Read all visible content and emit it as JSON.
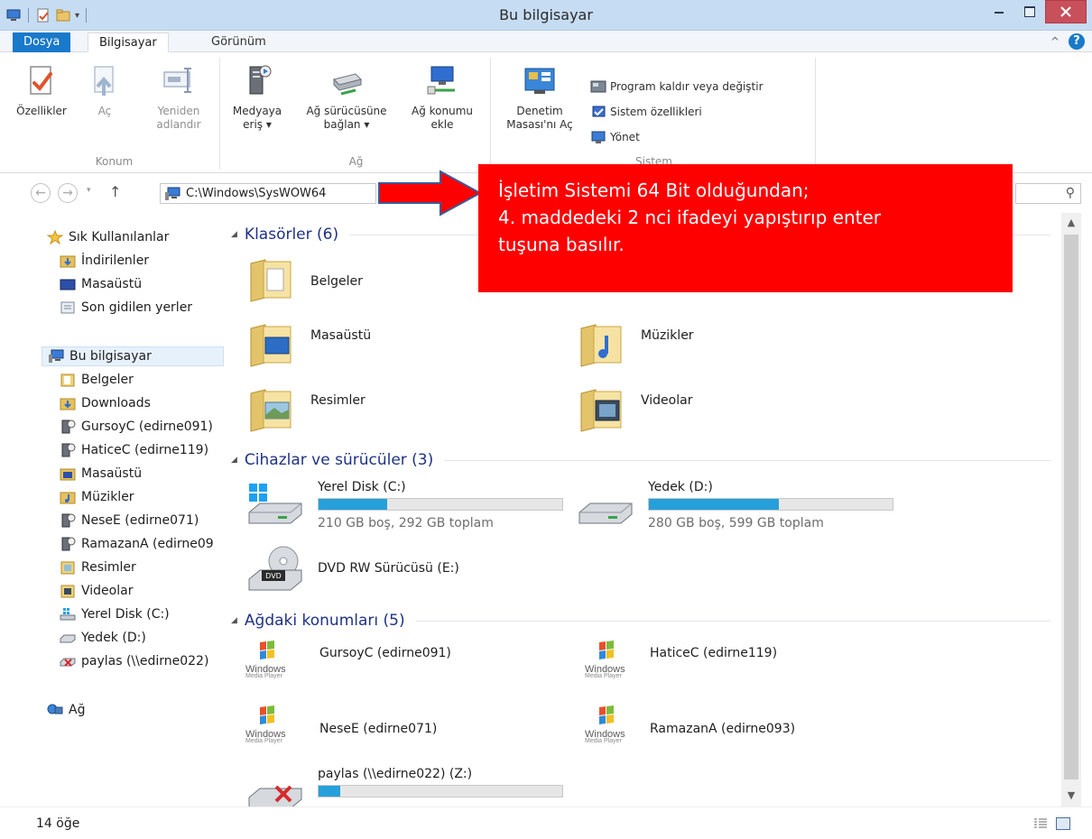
{
  "window": {
    "title": "Bu bilgisayar"
  },
  "ribbon": {
    "tabs": {
      "file": "Dosya",
      "computer": "Bilgisayar",
      "view": "Görünüm"
    },
    "collapse": "^",
    "help": "?",
    "groups": {
      "location": {
        "label": "Konum",
        "properties": "Özellikler",
        "open": "Aç",
        "rename_1": "Yeniden",
        "rename_2": "adlandır"
      },
      "network": {
        "label": "Ağ",
        "media_1": "Medyaya",
        "media_2": "eriş ▾",
        "drive_1": "Ağ sürücüsüne",
        "drive_2": "bağlan ▾",
        "location_1": "Ağ konumu",
        "location_2": "ekle"
      },
      "system": {
        "label": "Sistem",
        "control_1": "Denetim",
        "control_2": "Masası'nı Aç",
        "uninstall": "Program kaldır veya değiştir",
        "properties": "Sistem özellikleri",
        "manage": "Yönet"
      }
    }
  },
  "address": {
    "path": "C:\\Windows\\SysWOW64",
    "back": "←",
    "forward": "→",
    "dropdown": "▾",
    "up": "↑",
    "search_glyph": "⚲"
  },
  "navpane": {
    "favorites": {
      "header": "Sık Kullanılanlar",
      "items": [
        "İndirilenler",
        "Masaüstü",
        "Son gidilen yerler"
      ]
    },
    "computer": {
      "header": "Bu bilgisayar",
      "items": [
        "Belgeler",
        "Downloads",
        "GursoyC (edirne091)",
        "HaticeC (edirne119)",
        "Masaüstü",
        "Müzikler",
        "NeseE (edirne071)",
        "RamazanA (edirne09",
        "Resimler",
        "Videolar",
        "Yerel Disk (C:)",
        "Yedek (D:)",
        "paylas (\\\\edirne022)"
      ]
    },
    "network": "Ağ"
  },
  "content": {
    "folders": {
      "title": "Klasörler (6)",
      "items": [
        "Belgeler",
        "Masaüstü",
        "Müzikler",
        "Resimler",
        "Videolar"
      ]
    },
    "devices": {
      "title": "Cihazlar ve sürücüler (3)",
      "drives": [
        {
          "name": "Yerel Disk (C:)",
          "free": "210 GB boş, 292 GB toplam",
          "used_fraction": 0.281
        },
        {
          "name": "Yedek (D:)",
          "free": "280 GB boş, 599 GB toplam",
          "used_fraction": 0.533
        }
      ],
      "dvd": "DVD RW Sürücüsü (E:)",
      "dvd_badge": "DVD"
    },
    "network_locations": {
      "title": "Ağdaki konumları (5)",
      "items": [
        "GursoyC (edirne091)",
        "HaticeC (edirne119)",
        "NeseE (edirne071)",
        "RamazanA (edirne093)"
      ],
      "share": {
        "name": "paylas (\\\\edirne022) (Z:)",
        "used_fraction": 0.09
      },
      "wmp_logo": "Windows",
      "wmp_sub": "Media Player"
    },
    "group_triangle": "◢"
  },
  "statusbar": {
    "count": "14 öğe"
  },
  "scrollbar": {
    "up": "▲",
    "down": "▼"
  },
  "callout": {
    "line1": "İşletim Sistemi 64 Bit olduğundan;",
    "line2": "4. maddedeki 2 nci ifadeyi yapıştırıp enter",
    "line3": "tuşuna basılır."
  },
  "colors": {
    "accent": "#1979ca",
    "callout": "#ff0000",
    "group_title": "#1e3287",
    "drive_fill": "#26a0da"
  }
}
